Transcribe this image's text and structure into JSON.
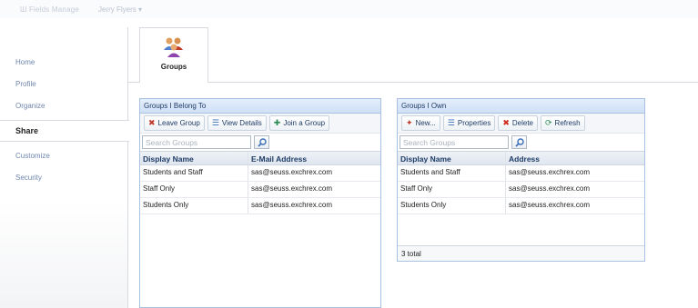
{
  "header": {
    "breadcrumb": "Ш Fields Manage",
    "user": "Jerry Flyers ▾"
  },
  "sidebar": {
    "items": [
      {
        "label": "Home"
      },
      {
        "label": "Profile"
      },
      {
        "label": "Organize"
      },
      {
        "label": "Share"
      },
      {
        "label": "Customize"
      },
      {
        "label": "Security"
      }
    ]
  },
  "tab": {
    "label": "Groups",
    "icon": "groups-icon"
  },
  "belong_panel": {
    "title": "Groups I Belong To",
    "toolbar": {
      "leave": "Leave Group",
      "view": "View Details",
      "join": "Join a Group"
    },
    "search_placeholder": "Search Groups",
    "columns": [
      "Display Name",
      "E-Mail Address"
    ],
    "rows": [
      [
        "Students and Staff",
        "sas@seuss.exchrex.com"
      ],
      [
        "Staff Only",
        "sas@seuss.exchrex.com"
      ],
      [
        "Students Only",
        "sas@seuss.exchrex.com"
      ]
    ]
  },
  "own_panel": {
    "title": "Groups I Own",
    "toolbar": {
      "new": "New...",
      "properties": "Properties",
      "delete": "Delete",
      "refresh": "Refresh"
    },
    "search_placeholder": "Search Groups",
    "columns": [
      "Display Name",
      "Address"
    ],
    "rows": [
      [
        "Students and Staff",
        "sas@seuss.exchrex.com"
      ],
      [
        "Staff Only",
        "sas@seuss.exchrex.com"
      ],
      [
        "Students Only",
        "sas@seuss.exchrex.com"
      ]
    ],
    "total": "3 total"
  }
}
